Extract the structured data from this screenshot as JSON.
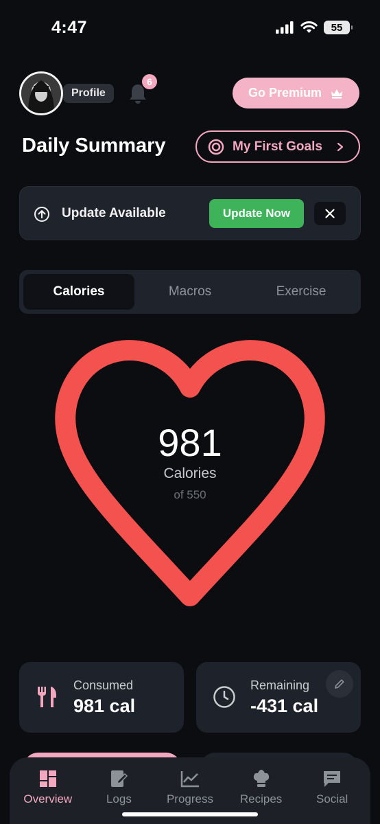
{
  "status_bar": {
    "time": "4:47",
    "battery": "55"
  },
  "header": {
    "profile_label": "Profile",
    "notification_count": "6",
    "premium_label": "Go Premium"
  },
  "summary": {
    "title": "Daily Summary",
    "goals_label": "My First Goals"
  },
  "update_banner": {
    "label": "Update Available",
    "button_label": "Update Now"
  },
  "tabs": [
    {
      "label": "Calories",
      "active": true
    },
    {
      "label": "Macros",
      "active": false
    },
    {
      "label": "Exercise",
      "active": false
    }
  ],
  "calorie_ring": {
    "value": "981",
    "unit": "Calories",
    "goal": "of 550"
  },
  "stats": {
    "consumed": {
      "label": "Consumed",
      "value": "981 cal"
    },
    "remaining": {
      "label": "Remaining",
      "value": "-431 cal"
    }
  },
  "bottom_nav": [
    {
      "label": "Overview",
      "icon": "dashboard-icon",
      "active": true
    },
    {
      "label": "Logs",
      "icon": "notebook-edit-icon",
      "active": false
    },
    {
      "label": "Progress",
      "icon": "chart-line-icon",
      "active": false
    },
    {
      "label": "Recipes",
      "icon": "chef-hat-icon",
      "active": false
    },
    {
      "label": "Social",
      "icon": "chat-icon",
      "active": false
    }
  ],
  "colors": {
    "background": "#0c0d11",
    "card": "#1e222a",
    "accent_pink": "#f3a8bf",
    "heart": "#f4524f",
    "update_green": "#3eb35a"
  }
}
